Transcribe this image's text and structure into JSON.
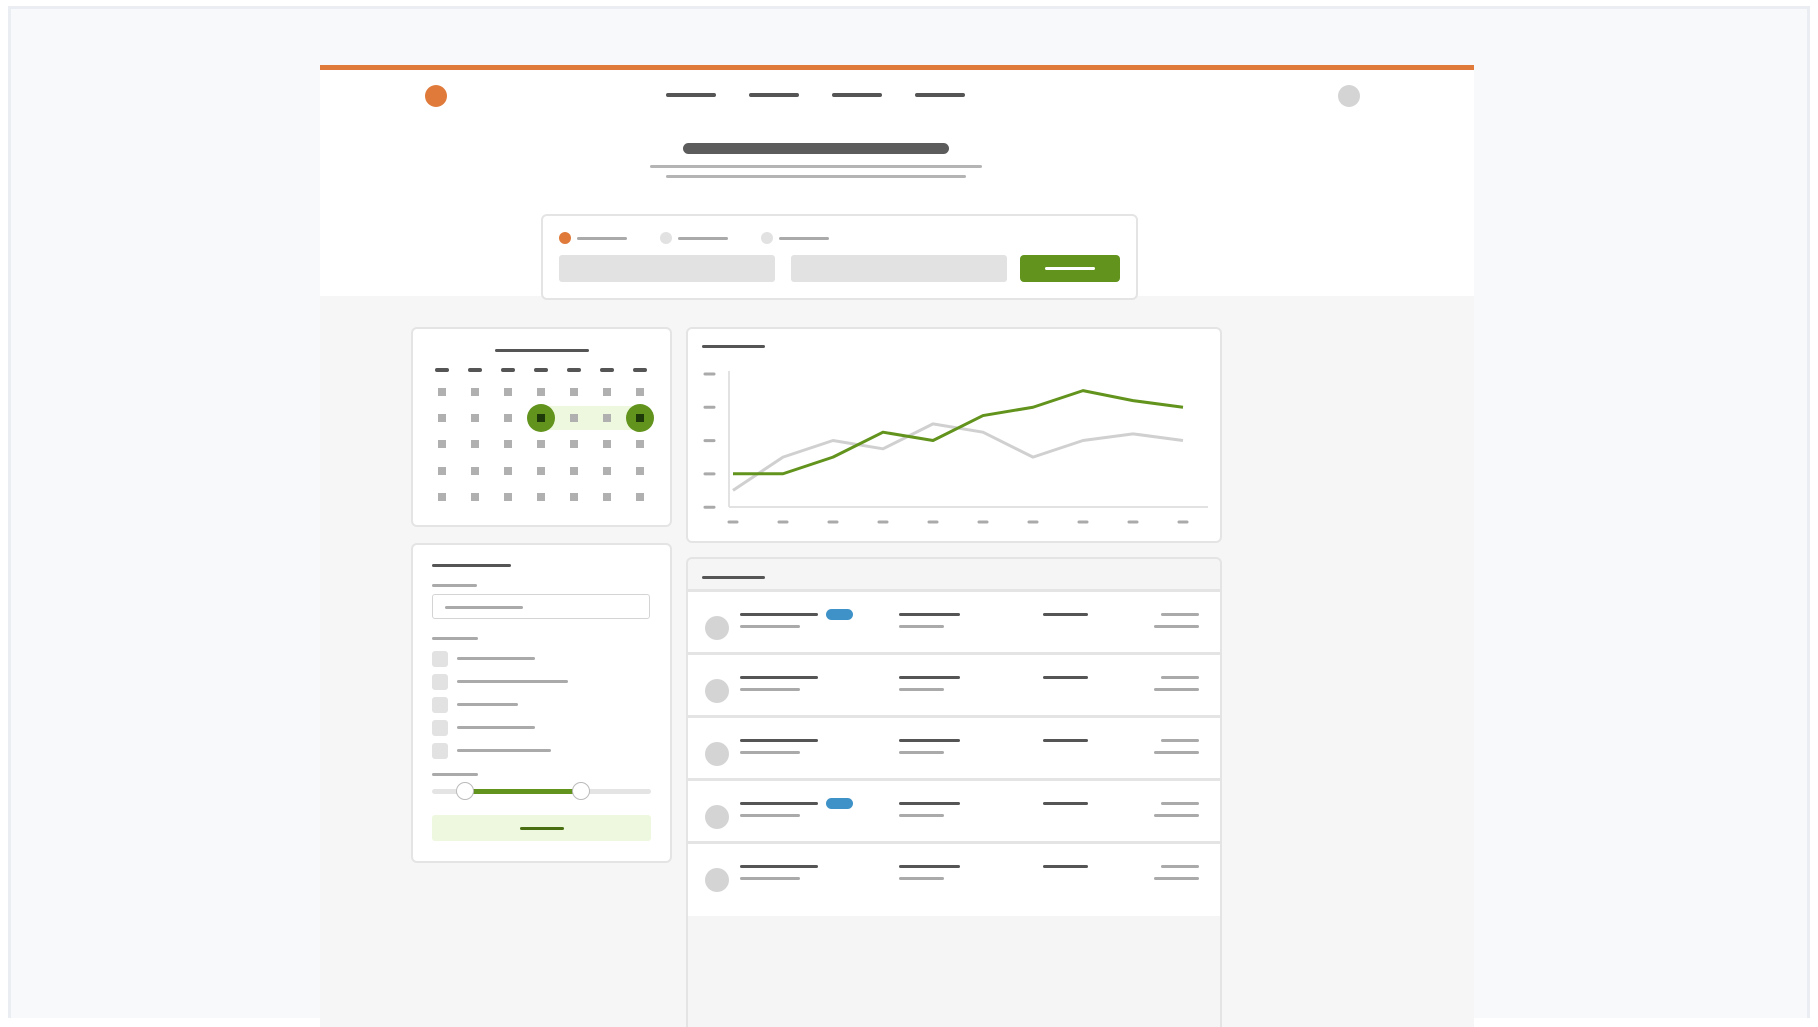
{
  "colors": {
    "accent": "#e07a3a",
    "primary_green": "#62931d",
    "range_highlight": "#eef8de",
    "badge_blue": "#3e92c8",
    "series_secondary": "#d0d0d0"
  },
  "header": {
    "logo_icon": "circle-logo",
    "nav_items": [
      "",
      "",
      "",
      ""
    ],
    "avatar_icon": "user-avatar-circle"
  },
  "search": {
    "trip_types": [
      "",
      "",
      ""
    ],
    "selected_trip_type_index": 0,
    "from_value": "",
    "to_value": "",
    "submit_label": ""
  },
  "calendar": {
    "selected_start": {
      "row": 1,
      "col": 3
    },
    "selected_end": {
      "row": 1,
      "col": 6
    }
  },
  "filters": {
    "checkbox_count": 5,
    "range_slider": {
      "low": 0.15,
      "high": 0.68
    }
  },
  "chart_data": {
    "type": "line",
    "title": "",
    "xlabel": "",
    "ylabel": "",
    "x": [
      1,
      2,
      3,
      4,
      5,
      6,
      7,
      8,
      9,
      10
    ],
    "ylim": [
      0,
      8
    ],
    "grid": false,
    "series": [
      {
        "values": [
          2.0,
          2.0,
          3.0,
          4.5,
          4.0,
          5.5,
          6.0,
          7.0,
          6.4,
          6.0
        ],
        "color": "#62931d"
      },
      {
        "values": [
          1.0,
          3.0,
          4.0,
          3.5,
          5.0,
          4.5,
          3.0,
          4.0,
          4.4,
          4.0
        ],
        "color": "#d0d0d0"
      }
    ]
  },
  "results": {
    "rows": [
      {
        "has_badge": true
      },
      {
        "has_badge": false
      },
      {
        "has_badge": false
      },
      {
        "has_badge": true
      },
      {
        "has_badge": false
      }
    ]
  }
}
